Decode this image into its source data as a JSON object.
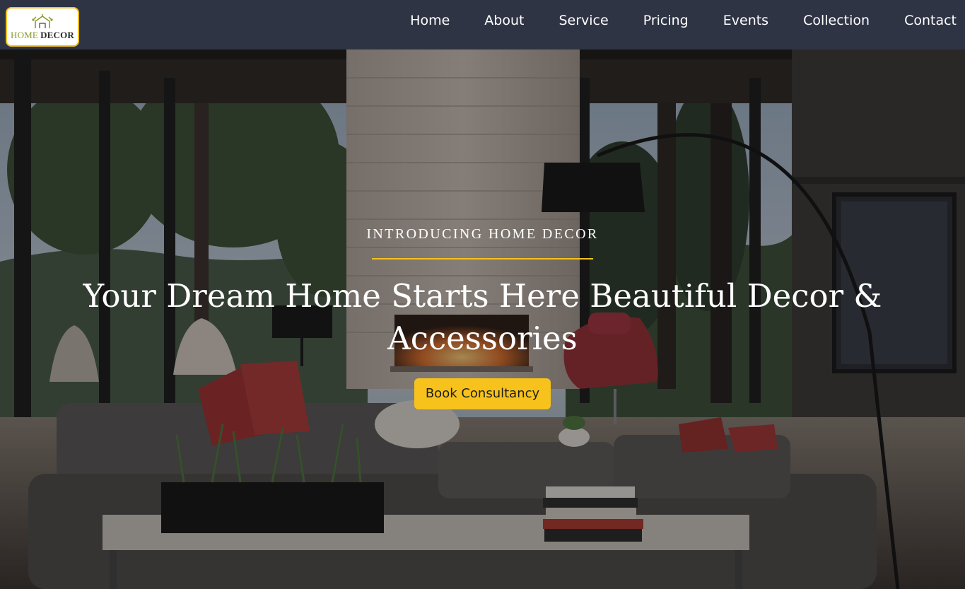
{
  "brand": {
    "logo_word1": "HOME",
    "logo_word2": "DECOR",
    "accent_color": "#f5c21b",
    "navbar_color": "#2f3445"
  },
  "nav": {
    "items": [
      {
        "label": "Home"
      },
      {
        "label": "About"
      },
      {
        "label": "Service"
      },
      {
        "label": "Pricing"
      },
      {
        "label": "Events"
      },
      {
        "label": "Collection"
      },
      {
        "label": "Contact"
      }
    ]
  },
  "hero": {
    "eyebrow": "INTRODUCING HOME DECOR",
    "headline": "Your Dream Home Starts Here Beautiful Decor & Accessories",
    "cta_label": "Book Consultancy",
    "cta_color": "#f7c21b"
  }
}
